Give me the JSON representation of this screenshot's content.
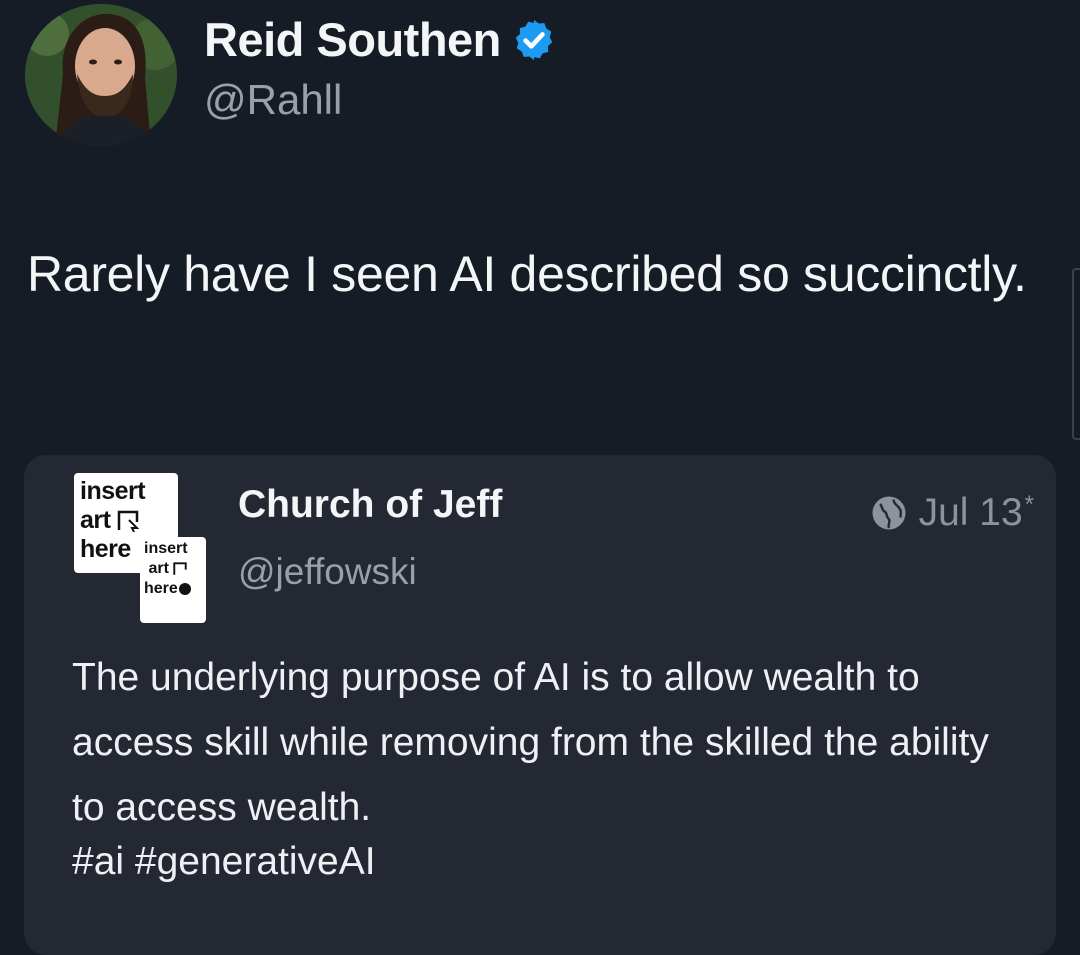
{
  "author": {
    "name": "Reid Southen",
    "handle": "@Rahll",
    "verified": true,
    "verified_icon": "verified-badge-icon",
    "verified_color": "#1d9bf0"
  },
  "tweet": {
    "text": "Rarely have I seen AI described so succinctly."
  },
  "quoted_post": {
    "logo_text_large": "insert art here",
    "logo_text_small": "insert art here",
    "name": "Church of Jeff",
    "handle": "@jeffowski",
    "date": "Jul 13",
    "date_mark": "*",
    "visibility_icon": "globe-icon",
    "body": "The underlying purpose of AI is to allow wealth to access skill while removing from the skilled the ability to access wealth.",
    "hashtags": "#ai #generativeAI"
  },
  "colors": {
    "background": "#161c26",
    "card": "#232833",
    "text": "#f4f5f7",
    "muted": "#98a0ab"
  }
}
